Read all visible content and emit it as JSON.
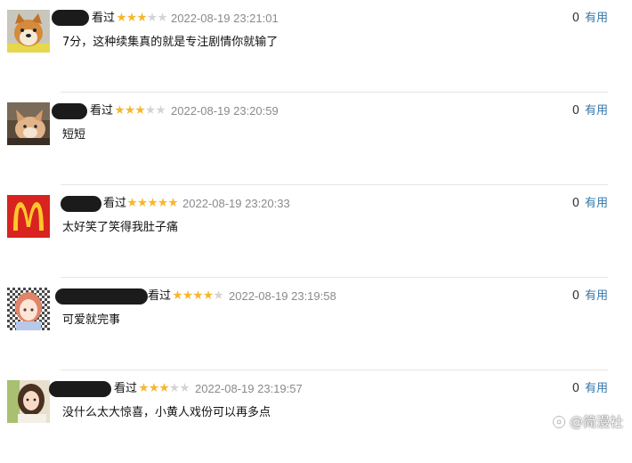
{
  "colors": {
    "star_on": "#f8b62d",
    "star_off": "#d4d4d4",
    "link": "#3377aa",
    "timestamp": "#8a8a8a"
  },
  "reviews": [
    {
      "avatar": "shiba-dog-avatar",
      "watched_label": "看过",
      "stars": 3,
      "max_stars": 5,
      "time": "2022-08-19 23:21:01",
      "useful_count": "0",
      "useful_label": "有用",
      "content": "7分，这种续集真的就是专注剧情你就输了"
    },
    {
      "avatar": "cat-avatar",
      "watched_label": "看过",
      "stars": 3,
      "max_stars": 5,
      "time": "2022-08-19 23:20:59",
      "useful_count": "0",
      "useful_label": "有用",
      "content": "短短"
    },
    {
      "avatar": "mcdonalds-logo-avatar",
      "watched_label": "看过",
      "stars": 5,
      "max_stars": 5,
      "time": "2022-08-19 23:20:33",
      "useful_count": "0",
      "useful_label": "有用",
      "content": "太好笑了笑得我肚子痛"
    },
    {
      "avatar": "anime-girl-avatar",
      "watched_label": "看过",
      "stars": 4,
      "max_stars": 5,
      "time": "2022-08-19 23:19:58",
      "useful_count": "0",
      "useful_label": "有用",
      "content": "可爱就完事"
    },
    {
      "avatar": "girl-photo-avatar",
      "watched_label": "看过",
      "stars": 3,
      "max_stars": 5,
      "time": "2022-08-19 23:19:57",
      "useful_count": "0",
      "useful_label": "有用",
      "content": "没什么太大惊喜，小黄人戏份可以再多点"
    }
  ],
  "watermark": {
    "text": "@简漫社",
    "icon": "watermark-logo-icon"
  }
}
